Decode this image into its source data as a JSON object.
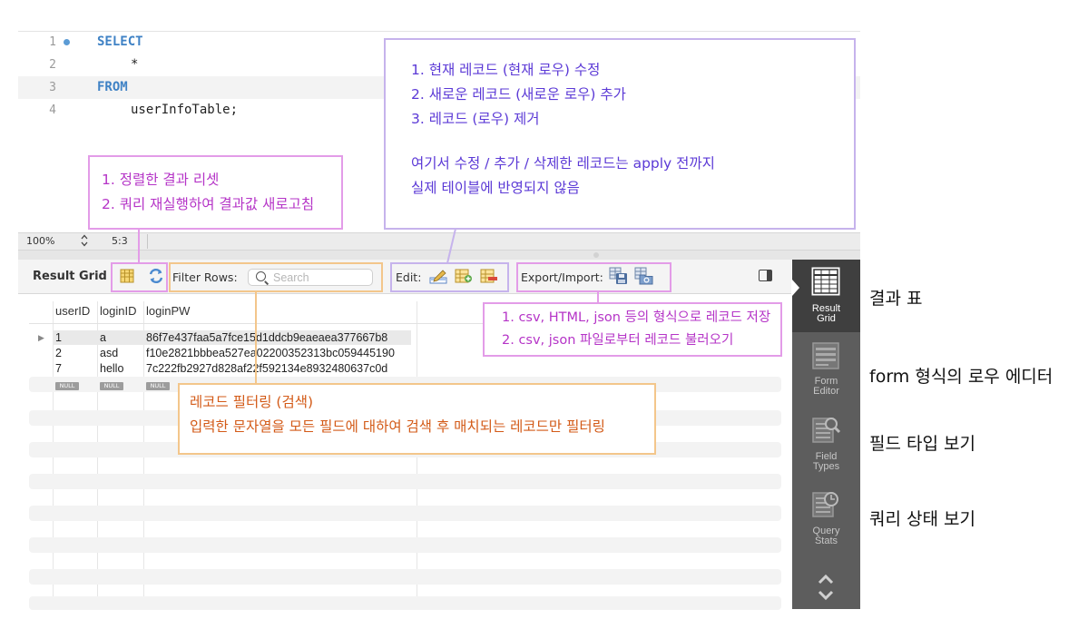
{
  "editor": {
    "lines": [
      {
        "num": "1",
        "text": "SELECT"
      },
      {
        "num": "2",
        "text": "*"
      },
      {
        "num": "3",
        "text": "FROM"
      },
      {
        "num": "4",
        "text": "userInfoTable;"
      }
    ]
  },
  "statusbar": {
    "zoom": "100%",
    "position": "5:3"
  },
  "toolbar": {
    "title": "Result Grid",
    "filter_label": "Filter Rows:",
    "search_placeholder": "Search",
    "edit_label": "Edit:",
    "export_label": "Export/Import:"
  },
  "grid": {
    "columns": [
      "userID",
      "loginID",
      "loginPW"
    ],
    "rows": [
      {
        "userID": "1",
        "loginID": "a",
        "loginPW": "86f7e437faa5a7fce15d1ddcb9eaeaea377667b8",
        "selected": true
      },
      {
        "userID": "2",
        "loginID": "asd",
        "loginPW": "f10e2821bbbea527ea02200352313bc059445190",
        "selected": false
      },
      {
        "userID": "7",
        "loginID": "hello",
        "loginPW": "7c222fb2927d828af22f592134e8932480637c0d",
        "selected": false
      }
    ],
    "null_label": "NULL"
  },
  "sidepanel": {
    "items": [
      {
        "line1": "Result",
        "line2": "Grid",
        "icon": "grid-icon",
        "active": true
      },
      {
        "line1": "Form",
        "line2": "Editor",
        "icon": "form-icon",
        "active": false
      },
      {
        "line1": "Field",
        "line2": "Types",
        "icon": "field-types-icon",
        "active": false
      },
      {
        "line1": "Query",
        "line2": "Stats",
        "icon": "query-stats-icon",
        "active": false
      }
    ]
  },
  "captions": {
    "result_table": "결과 표",
    "form_editor": "form 형식의 로우 에디터",
    "field_types": "필드 타입 보기",
    "query_stats": "쿼리 상태 보기"
  },
  "annotations": {
    "edit": [
      "1. 현재 레코드 (현재 로우) 수정",
      "2. 새로운 레코드 (새로운 로우) 추가",
      "3. 레코드 (로우) 제거",
      "",
      "여기서 수정 / 추가 / 삭제한 레코드는 apply 전까지",
      "실제 테이블에 반영되지 않음"
    ],
    "grid_reset": [
      "1. 정렬한 결과 리셋",
      "2. 쿼리 재실행하여 결과값 새로고침"
    ],
    "export": [
      "1. csv, HTML, json 등의 형식으로 레코드 저장",
      "2. csv, json 파일로부터 레코드 불러오기"
    ],
    "filter": [
      "레코드 필터링 (검색)",
      "입력한 문자열을 모든 필드에 대하여 검색 후 매치되는 레코드만 필터링"
    ]
  },
  "colors": {
    "purple": "#c6b3ec",
    "pink": "#e39ce8",
    "orange": "#f3c68b",
    "keyword": "#3f82c5",
    "sidepanel": "#5d5d5d"
  }
}
